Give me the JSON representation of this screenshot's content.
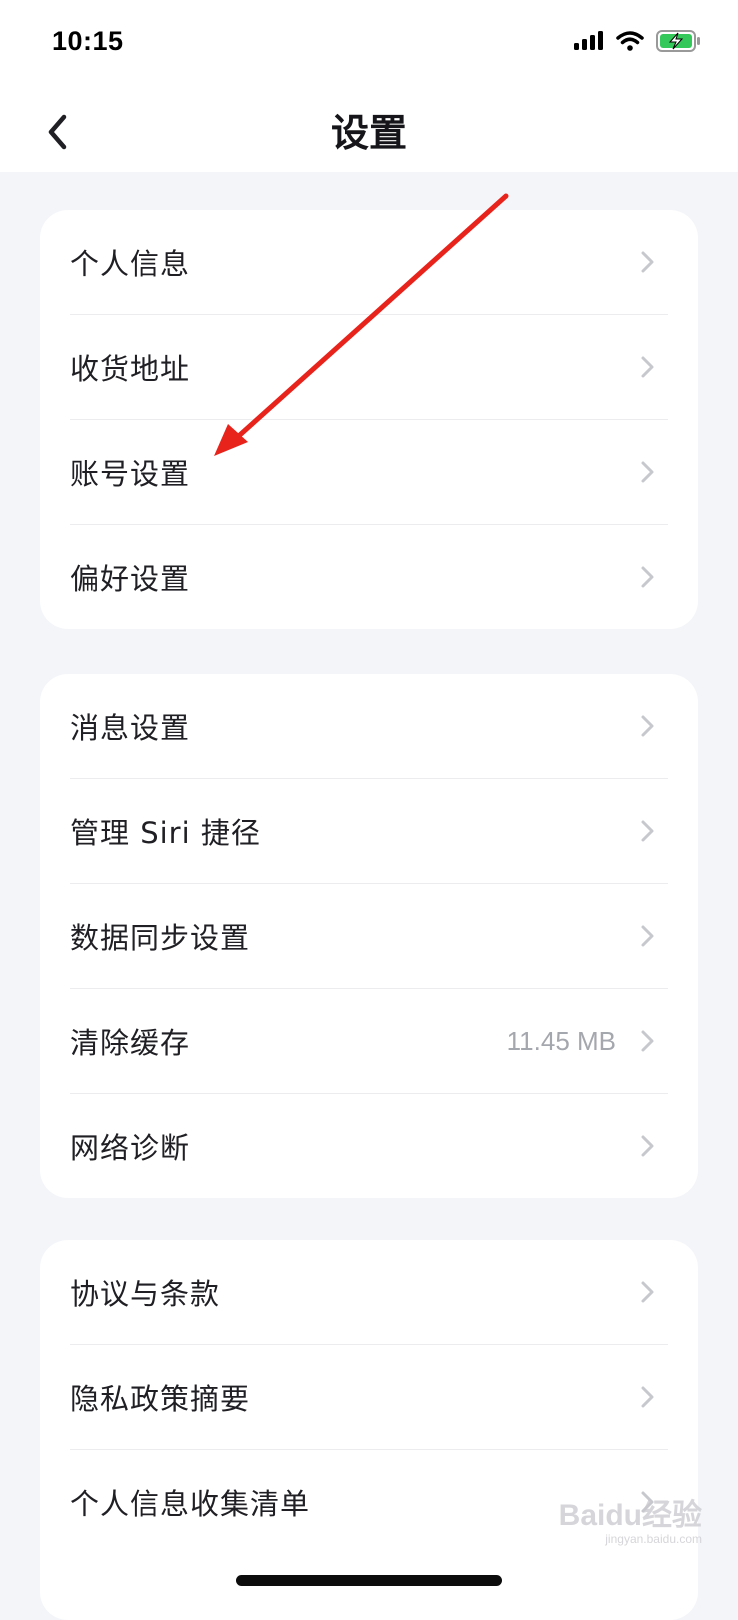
{
  "status": {
    "time": "10:15",
    "icons": [
      "signal-icon",
      "wifi-icon",
      "battery-charging-icon"
    ],
    "battery_color": "#34c759"
  },
  "header": {
    "title": "设置",
    "back_icon": "chevron-left-icon"
  },
  "groups": [
    {
      "items": [
        {
          "label": "个人信息"
        },
        {
          "label": "收货地址"
        },
        {
          "label": "账号设置"
        },
        {
          "label": "偏好设置"
        }
      ]
    },
    {
      "items": [
        {
          "label": "消息设置"
        },
        {
          "label": "管理 Siri 捷径"
        },
        {
          "label": "数据同步设置"
        },
        {
          "label": "清除缓存",
          "value": "11.45 MB"
        },
        {
          "label": "网络诊断"
        }
      ]
    },
    {
      "items": [
        {
          "label": "协议与条款"
        },
        {
          "label": "隐私政策摘要"
        },
        {
          "label": "个人信息收集清单"
        }
      ]
    }
  ],
  "annotation": {
    "arrow_color": "#e8231c",
    "points_to": "账号设置"
  },
  "watermark": {
    "brand": "Baidu经验",
    "url": "jingyan.baidu.com"
  },
  "colors": {
    "background": "#f4f5f9",
    "card": "#ffffff",
    "secondary_text": "#a5a7ae",
    "chevron": "#c7c8cd"
  }
}
